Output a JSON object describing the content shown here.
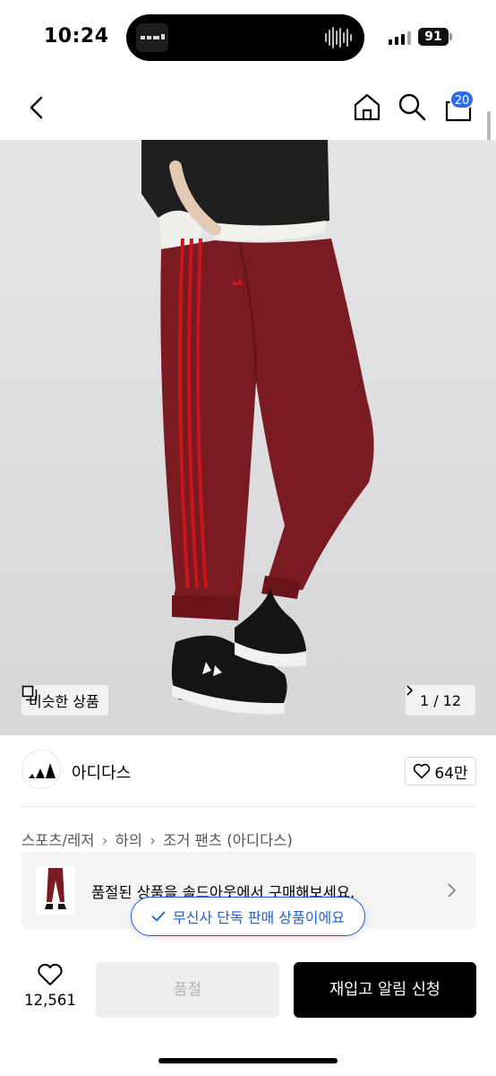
{
  "status_bar": {
    "time": "10:24",
    "battery": "91"
  },
  "nav": {
    "cart_count": "20"
  },
  "hero": {
    "similar_label": "비슷한 상품",
    "pager": "1 / 12",
    "pants_color": "#7a1a22",
    "stripe_color": "#c8161f"
  },
  "brand": {
    "name": "아디다스",
    "likes": "64만"
  },
  "breadcrumb": [
    "스포츠/레저",
    "하의",
    "조거 팬츠 (아디다스)"
  ],
  "soldout_notice": "품절된 상품을 솔드아웃에서 구매해보세요.",
  "exclusive_label": "무신사 단독 판매 상품이에요",
  "bottom_bar": {
    "wish_count": "12,561",
    "soldout_label": "품절",
    "restock_label": "재입고 알림 신청"
  },
  "colors": {
    "accent": "#2b6cf0",
    "exclusive": "#1f5fd6"
  }
}
